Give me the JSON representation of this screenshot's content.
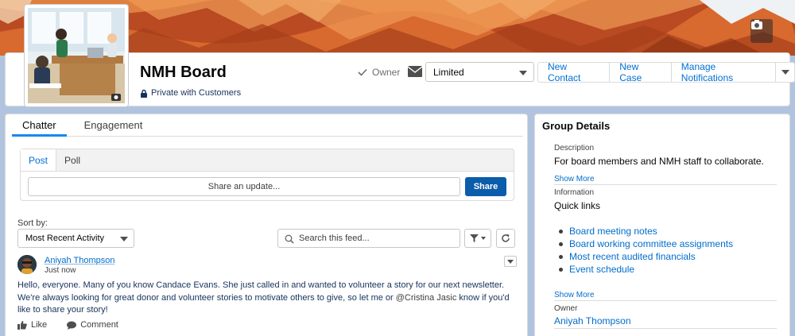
{
  "group": {
    "name": "NMH Board",
    "privacy": "Private with Customers"
  },
  "header": {
    "owner_label": "Owner",
    "notification_level": "Limited",
    "buttons": [
      "New Contact",
      "New Case",
      "Manage Notifications"
    ]
  },
  "tabs": [
    "Chatter",
    "Engagement"
  ],
  "publisher": {
    "tabs": [
      "Post",
      "Poll"
    ],
    "placeholder": "Share an update...",
    "share_label": "Share"
  },
  "feed": {
    "sort_label": "Sort by:",
    "sort_value": "Most Recent Activity",
    "search_placeholder": "Search this feed...",
    "post": {
      "author": "Aniyah Thompson",
      "time": "Just now",
      "body_before": "Hello, everyone. Many of you know Candace Evans. She just called in and wanted to volunteer a story for our next newsletter. We're always looking for great donor and volunteer stories to motivate others to give, so let me or ",
      "mention": "@Cristina Jasic",
      "body_after": " know if you'd like to share your story!",
      "like_label": "Like",
      "comment_label": "Comment"
    }
  },
  "details": {
    "title": "Group Details",
    "description_label": "Description",
    "description": "For board members and NMH staff to collaborate.",
    "show_more": "Show More",
    "information_label": "Information",
    "information_heading": "Quick links",
    "links": [
      "Board meeting notes",
      "Board working committee assignments",
      "Most recent audited financials",
      "Event schedule"
    ],
    "owner_label": "Owner",
    "owner_name": "Aniyah Thompson"
  },
  "colors": {
    "accent": "#0070d2",
    "share_button": "#0b5cab",
    "background": "#b0c4df"
  }
}
